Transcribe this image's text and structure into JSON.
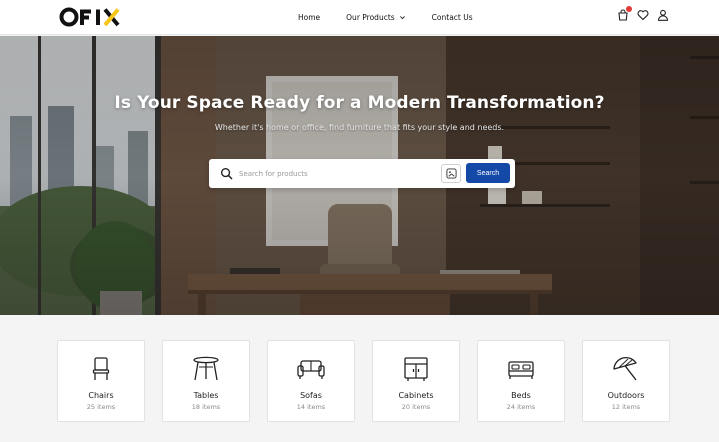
{
  "brand": {
    "logo_text": "OFIX",
    "accent": "#f5c518"
  },
  "nav": [
    {
      "label": "Home"
    },
    {
      "label": "Our Products"
    },
    {
      "label": "Contact Us"
    }
  ],
  "header_icons": [
    "cart-icon",
    "heart-icon",
    "user-icon"
  ],
  "hero": {
    "title": "Is Your Space Ready for a Modern Transformation?",
    "subtitle": "Whether it's home or office, find furniture that fits your style and needs."
  },
  "search": {
    "placeholder": "Search for products",
    "button_label": "Search"
  },
  "colors": {
    "primary": "#1549a8",
    "badge": "#e53935"
  },
  "categories": [
    {
      "name": "Chairs",
      "count": "25 items",
      "icon": "chair-icon"
    },
    {
      "name": "Tables",
      "count": "18 items",
      "icon": "table-icon"
    },
    {
      "name": "Sofas",
      "count": "14 items",
      "icon": "sofa-icon"
    },
    {
      "name": "Cabinets",
      "count": "20 items",
      "icon": "cabinet-icon"
    },
    {
      "name": "Beds",
      "count": "24 items",
      "icon": "bed-icon"
    },
    {
      "name": "Outdoors",
      "count": "12 items",
      "icon": "umbrella-icon"
    }
  ]
}
